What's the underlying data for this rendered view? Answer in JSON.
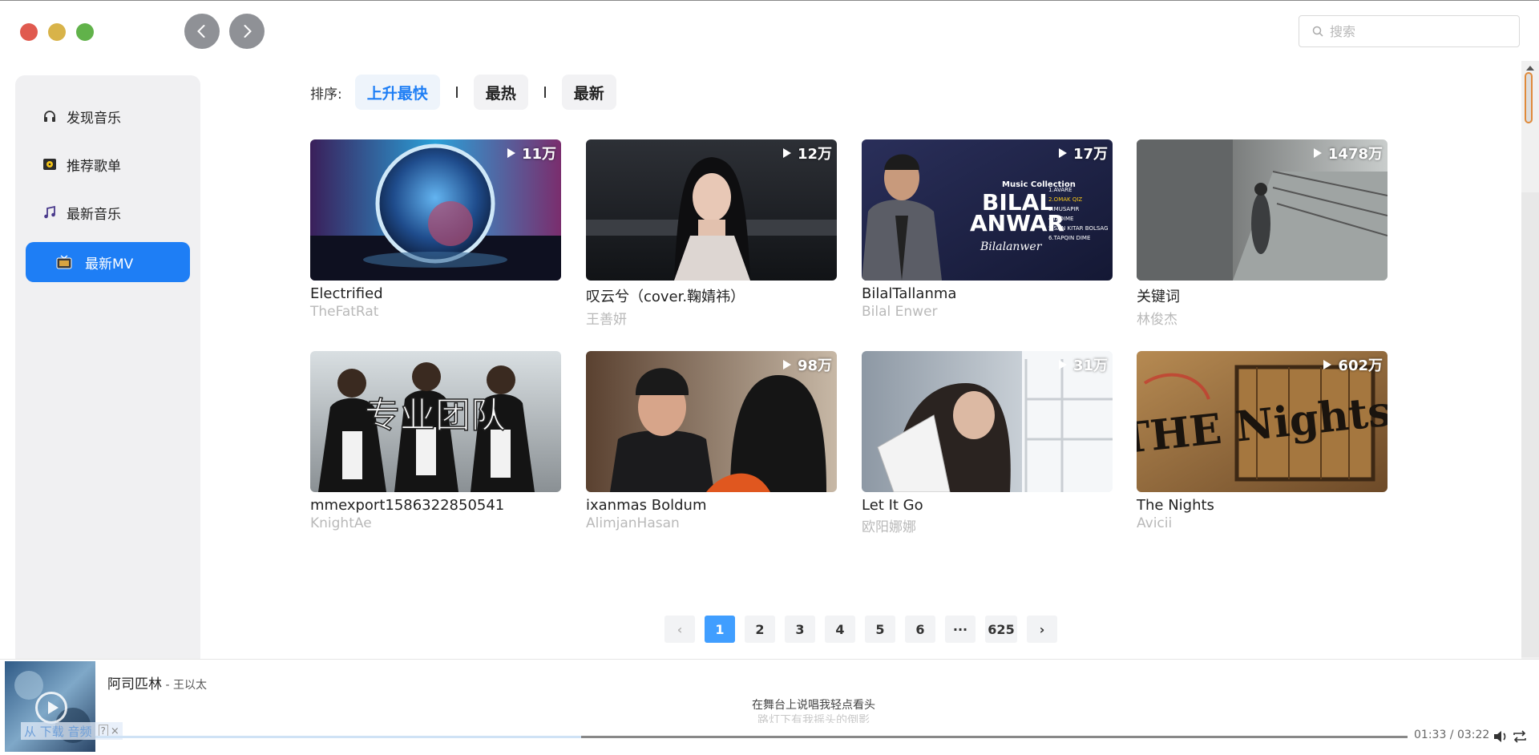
{
  "search": {
    "placeholder": "搜索"
  },
  "sidebar": {
    "items": [
      {
        "label": "发现音乐",
        "icon": "headphones-icon"
      },
      {
        "label": "推荐歌单",
        "icon": "playlist-icon"
      },
      {
        "label": "最新音乐",
        "icon": "music-note-icon"
      },
      {
        "label": "最新MV",
        "icon": "tv-icon",
        "active": true
      }
    ]
  },
  "sort": {
    "label": "排序:",
    "options": [
      "上升最快",
      "最热",
      "最新"
    ],
    "active": "上升最快"
  },
  "mvs": [
    {
      "title": "Electrified",
      "artist": "TheFatRat",
      "plays": "11万"
    },
    {
      "title": "叹云兮（cover.鞠婧祎）",
      "artist": "王善妍",
      "plays": "12万"
    },
    {
      "title": "BilalTallanma",
      "artist": "Bilal Enwer",
      "plays": "17万"
    },
    {
      "title": "关键词",
      "artist": "林俊杰",
      "plays": "1478万"
    },
    {
      "title": "mmexport1586322850541",
      "artist": "KnightAe",
      "plays": ""
    },
    {
      "title": "ixanmas Boldum",
      "artist": "AlimjanHasan",
      "plays": "98万"
    },
    {
      "title": "Let It Go",
      "artist": "欧阳娜娜",
      "plays": "31万"
    },
    {
      "title": "The Nights",
      "artist": "Avicii",
      "plays": "602万"
    }
  ],
  "thumb_overlays": {
    "bilal_collection": "Music Collection",
    "bilal_name1": "BILAL",
    "bilal_name2": "ANWAR",
    "bilal_sign": "Bilalanwer",
    "bilal_tracks": [
      "1.AVARE",
      "2.OMAK QIZ",
      "3.MUSAPIR",
      "4.IZDIME",
      "5.SAN KITAR BOLSAG",
      "6.TAPQIN DIME"
    ],
    "coffin_text": "专业团队",
    "nights_text": "THE Nights"
  },
  "pagination": {
    "pages": [
      "1",
      "2",
      "3",
      "4",
      "5",
      "6",
      "···",
      "625"
    ],
    "current": "1",
    "prev": "‹",
    "next": "›"
  },
  "player": {
    "song": "阿司匹林",
    "artist": " - 王以太",
    "lyric_current": "在舞台上说唱我轻点看头",
    "lyric_next": "路灯下有我摇头的倒影",
    "download_text": "从  下载 音频",
    "download_help": "?",
    "download_close": "×",
    "time": "01:33 / 03:22",
    "progress": 0.37
  },
  "colors": {
    "accent": "#1e7ef5",
    "pager_active": "#409eff"
  }
}
